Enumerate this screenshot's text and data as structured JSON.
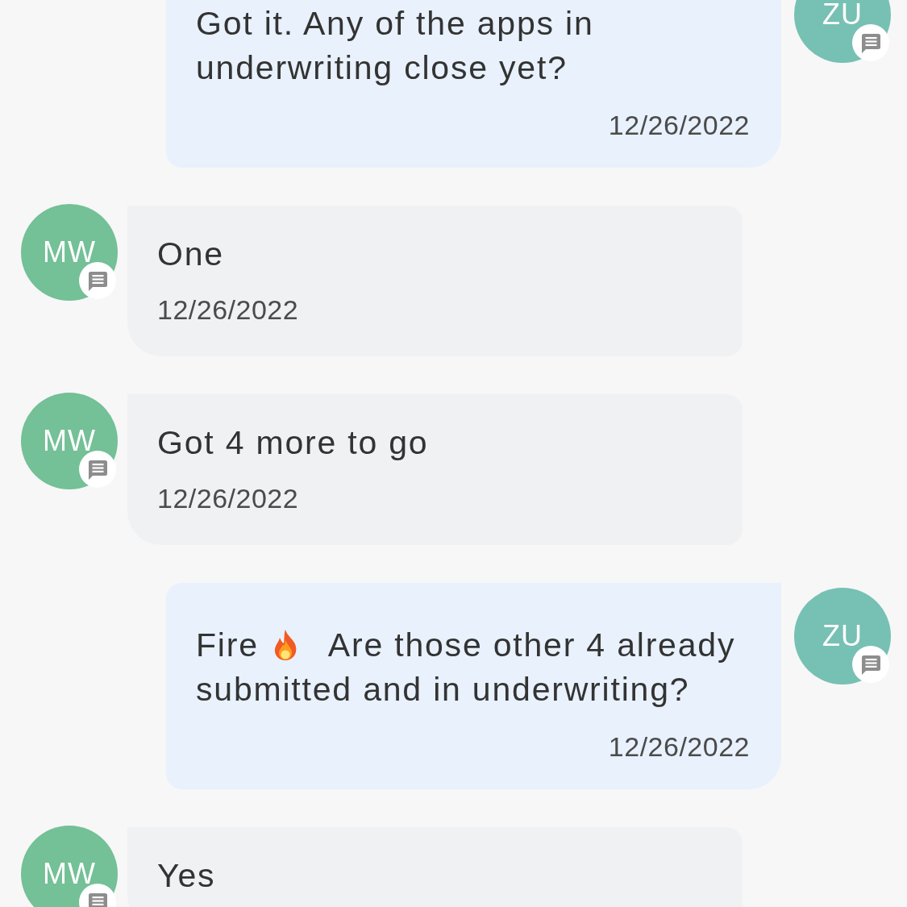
{
  "messages": [
    {
      "kind": "sent",
      "avatar": {
        "initials": "ZU",
        "color": "#77c0b4"
      },
      "parts": [
        {
          "kind": "text",
          "text": "Got it. Any of the apps in underwriting close yet?"
        }
      ],
      "date": "12/26/2022"
    },
    {
      "kind": "received",
      "avatar": {
        "initials": "MW",
        "color": "#74c097"
      },
      "parts": [
        {
          "kind": "text",
          "text": "One"
        }
      ],
      "date": "12/26/2022"
    },
    {
      "kind": "received",
      "avatar": {
        "initials": "MW",
        "color": "#74c097"
      },
      "parts": [
        {
          "kind": "text",
          "text": "Got 4 more to go"
        }
      ],
      "date": "12/26/2022"
    },
    {
      "kind": "sent",
      "avatar": {
        "initials": "ZU",
        "color": "#77c0b4"
      },
      "parts": [
        {
          "kind": "text",
          "text": "Fire"
        },
        {
          "kind": "flame"
        },
        {
          "kind": "text",
          "text": "Are those other 4 already submitted and in underwriting?"
        }
      ],
      "date": "12/26/2022"
    },
    {
      "kind": "received",
      "avatar": {
        "initials": "MW",
        "color": "#74c097"
      },
      "parts": [
        {
          "kind": "text",
          "text": "Yes"
        }
      ]
    }
  ]
}
